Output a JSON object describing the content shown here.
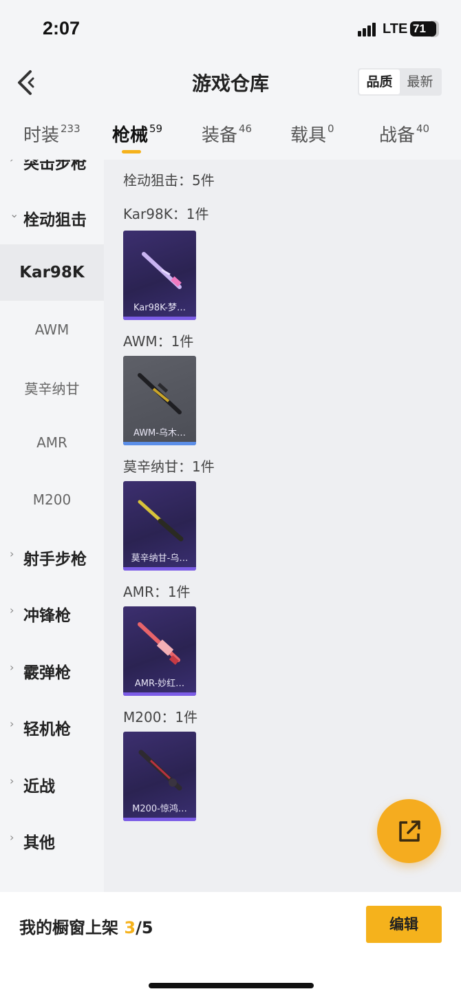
{
  "status_bar": {
    "time": "2:07",
    "network": "LTE",
    "battery": "71"
  },
  "nav": {
    "title": "游戏仓库",
    "sort_options": [
      "品质",
      "最新"
    ],
    "sort_selected": "品质"
  },
  "tabs": [
    {
      "label": "时装",
      "count": "233"
    },
    {
      "label": "枪械",
      "count": "59",
      "active": true
    },
    {
      "label": "装备",
      "count": "46"
    },
    {
      "label": "载具",
      "count": "0"
    },
    {
      "label": "战备",
      "count": "40"
    }
  ],
  "sidebar": {
    "items": [
      {
        "label": "突击步枪",
        "type": "category",
        "expanded": false
      },
      {
        "label": "栓动狙击",
        "type": "category",
        "expanded": true
      },
      {
        "label": "Kar98K",
        "type": "sub",
        "selected": true
      },
      {
        "label": "AWM",
        "type": "sub"
      },
      {
        "label": "莫辛纳甘",
        "type": "sub"
      },
      {
        "label": "AMR",
        "type": "sub"
      },
      {
        "label": "M200",
        "type": "sub"
      },
      {
        "label": "射手步枪",
        "type": "category"
      },
      {
        "label": "冲锋枪",
        "type": "category"
      },
      {
        "label": "霰弹枪",
        "type": "category"
      },
      {
        "label": "轻机枪",
        "type": "category"
      },
      {
        "label": "近战",
        "type": "category"
      },
      {
        "label": "其他",
        "type": "category"
      }
    ]
  },
  "main": {
    "section_title": "栓动狙击：5件",
    "groups": [
      {
        "title": "Kar98K：1件",
        "item": {
          "caption": "Kar98K-梦…",
          "rarity": "purple",
          "gun_color": "#c9b4f2"
        }
      },
      {
        "title": "AWM：1件",
        "item": {
          "caption": "AWM-乌木…",
          "rarity": "grey",
          "gun_color": "#c9a52a"
        }
      },
      {
        "title": "莫辛纳甘：1件",
        "item": {
          "caption": "莫辛纳甘-乌…",
          "rarity": "purple",
          "gun_color": "#d8c33a"
        }
      },
      {
        "title": "AMR：1件",
        "item": {
          "caption": "AMR-妙红…",
          "rarity": "purple",
          "gun_color": "#e8646a"
        }
      },
      {
        "title": "M200：1件",
        "item": {
          "caption": "M200-惊鸿…",
          "rarity": "purple",
          "gun_color": "#b8323e"
        }
      }
    ]
  },
  "bottom_bar": {
    "showcase_label": "我的橱窗上架",
    "showcase_current": "3",
    "showcase_total": "/5",
    "edit_label": "编辑"
  },
  "colors": {
    "accent": "#f5b21c",
    "purple_rarity": "#7b5ce6",
    "grey_rarity": "#5b8ee8"
  }
}
